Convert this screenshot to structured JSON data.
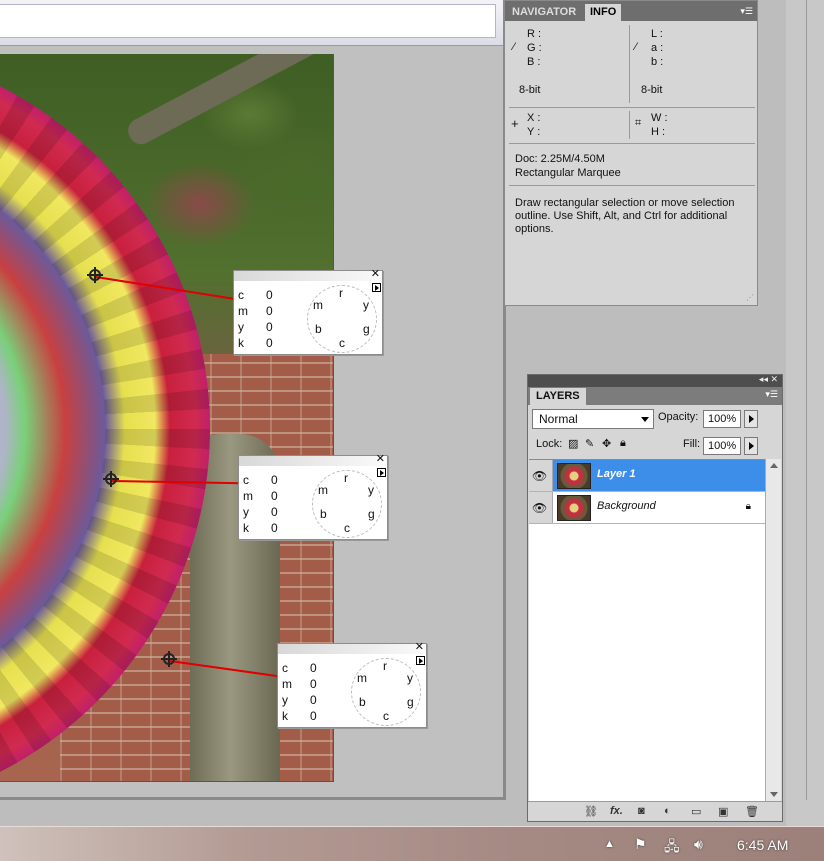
{
  "info_panel": {
    "tabs": [
      "NAVIGATOR",
      "INFO"
    ],
    "rgb_labels": [
      "R :",
      "G :",
      "B :"
    ],
    "lab_labels": [
      "L :",
      "a :",
      "b :"
    ],
    "bit_left": "8-bit",
    "bit_right": "8-bit",
    "xy_labels": [
      "X :",
      "Y :"
    ],
    "wh_labels": [
      "W :",
      "H :"
    ],
    "doc_size": "Doc: 2.25M/4.50M",
    "tool_name": "Rectangular Marquee",
    "hint_lines": [
      "Draw rectangular selection or move selection",
      "outline.  Use Shift, Alt, and Ctrl for additional",
      "options."
    ]
  },
  "samplers": [
    {
      "labels": [
        "c",
        "m",
        "y",
        "k"
      ],
      "values": [
        "0",
        "0",
        "0",
        "0"
      ],
      "wheel": [
        "r",
        "y",
        "g",
        "c",
        "b",
        "m"
      ]
    },
    {
      "labels": [
        "c",
        "m",
        "y",
        "k"
      ],
      "values": [
        "0",
        "0",
        "0",
        "0"
      ],
      "wheel": [
        "r",
        "y",
        "g",
        "c",
        "b",
        "m"
      ]
    },
    {
      "labels": [
        "c",
        "m",
        "y",
        "k"
      ],
      "values": [
        "0",
        "0",
        "0",
        "0"
      ],
      "wheel": [
        "r",
        "y",
        "g",
        "c",
        "b",
        "m"
      ]
    }
  ],
  "layers_panel": {
    "title": "LAYERS",
    "blend_mode": "Normal",
    "opacity_label": "Opacity:",
    "opacity_value": "100%",
    "lock_label": "Lock:",
    "fill_label": "Fill:",
    "fill_value": "100%",
    "layers": [
      {
        "name": "Layer 1",
        "selected": true
      },
      {
        "name": "Background",
        "selected": false
      }
    ],
    "footer_icons": [
      "link-icon",
      "fx-icon",
      "mask-icon",
      "adjustment-icon",
      "group-icon",
      "new-layer-icon",
      "trash-icon"
    ]
  },
  "taskbar": {
    "clock": "6:45 AM",
    "tray_icons": [
      "show-hidden-icon",
      "flag-icon",
      "network-icon",
      "volume-icon"
    ]
  },
  "colors": {
    "selected_layer": "#3d8ee8",
    "sampler_line": "#e00000",
    "panel_bg": "#d6d6d6"
  }
}
